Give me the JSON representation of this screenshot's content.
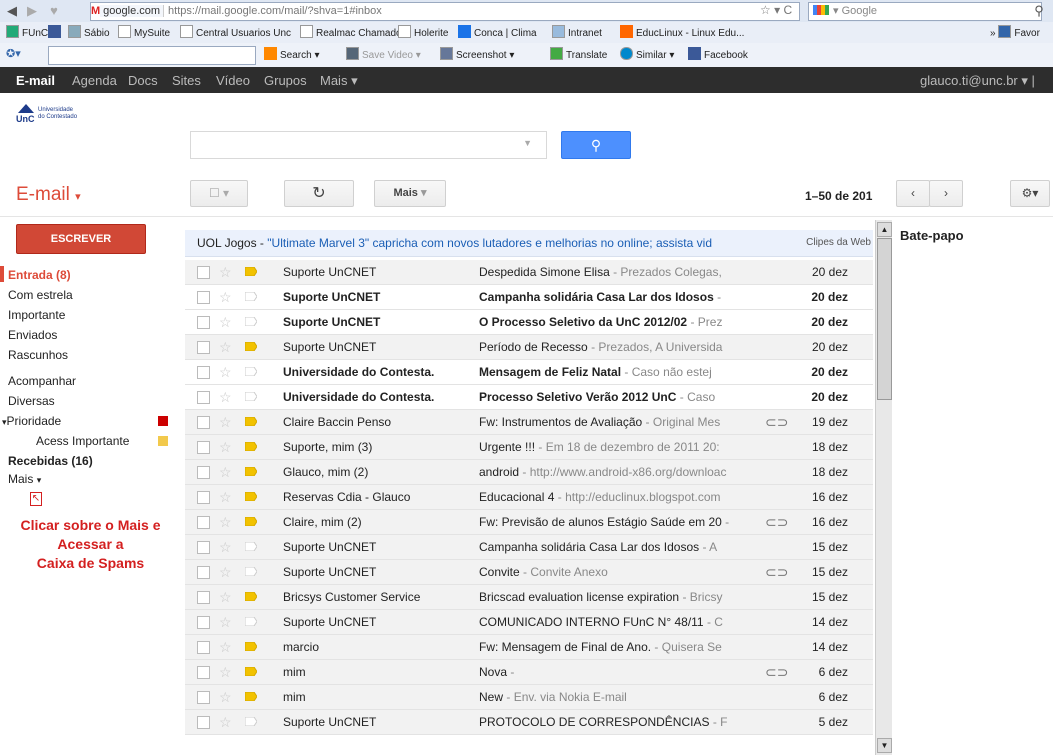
{
  "browser": {
    "domain": "google.com",
    "url": "https://mail.google.com/mail/?shva=1#inbox",
    "search_engine": "Google",
    "bookmarks": [
      "FUnC",
      "Sábio",
      "MySuite",
      "Central Usuarios Unc",
      "Realmac Chamados",
      "Holerite",
      "Conca | Clima",
      "Intranet",
      "EducLinux - Linux Edu...",
      "Favor"
    ],
    "toolbar": [
      "Search",
      "Save Video",
      "Screenshot",
      "Translate",
      "Similar",
      "Facebook"
    ]
  },
  "gbar": {
    "items": [
      "E-mail",
      "Agenda",
      "Docs",
      "Sites",
      "Vídeo",
      "Grupos",
      "Mais"
    ],
    "account": "glauco.ti@unc.br"
  },
  "logo": {
    "line1": "Universidade",
    "line2": "do Contestado",
    "mark": "UnC"
  },
  "header": {
    "mail_label": "E-mail",
    "more_button": "Mais",
    "pager": "1–50 de 201"
  },
  "sidebar": {
    "compose": "ESCREVER",
    "items": [
      {
        "label": "Entrada (8)"
      },
      {
        "label": "Com estrela"
      },
      {
        "label": "Importante"
      },
      {
        "label": "Enviados"
      },
      {
        "label": "Rascunhos"
      },
      {
        "label": "Acompanhar"
      },
      {
        "label": "Diversas"
      },
      {
        "label": "Prioridade"
      },
      {
        "label": "Acess Importante"
      },
      {
        "label": "Recebidas (16)"
      },
      {
        "label": "Mais"
      }
    ],
    "annotation": [
      "Clicar sobre o Mais e",
      "Acessar a",
      "Caixa de Spams"
    ]
  },
  "promo": {
    "source": "UOL Jogos",
    "text": "\"Ultimate Marvel 3\" capricha com novos lutadores e melhorias no online; assista vid",
    "clips": "Clipes da Web"
  },
  "emails": [
    {
      "sender": "Suporte UnCNET",
      "subject": "Despedida Simone Elisa",
      "snippet": "Prezados Colegas,",
      "date": "20 dez",
      "unread": false,
      "important": true,
      "attach": false
    },
    {
      "sender": "Suporte UnCNET",
      "subject": "Campanha solidária Casa Lar dos Idosos",
      "snippet": "",
      "date": "20 dez",
      "unread": true,
      "important": false,
      "attach": false
    },
    {
      "sender": "Suporte UnCNET",
      "subject": "O Processo Seletivo da UnC 2012/02",
      "snippet": "Prez",
      "date": "20 dez",
      "unread": true,
      "important": false,
      "attach": false
    },
    {
      "sender": "Suporte UnCNET",
      "subject": "Período de Recesso",
      "snippet": "Prezados, A Universida",
      "date": "20 dez",
      "unread": false,
      "important": true,
      "attach": false
    },
    {
      "sender": "Universidade do Contesta.",
      "subject": "Mensagem de Feliz Natal",
      "snippet": "Caso não estej",
      "date": "20 dez",
      "unread": true,
      "important": false,
      "attach": false
    },
    {
      "sender": "Universidade do Contesta.",
      "subject": "Processo Seletivo Verão 2012 UnC",
      "snippet": "Caso",
      "date": "20 dez",
      "unread": true,
      "important": false,
      "attach": false
    },
    {
      "sender": "Claire Baccin Penso",
      "subject": "Fw: Instrumentos de Avaliação",
      "snippet": "Original Mes",
      "date": "19 dez",
      "unread": false,
      "important": true,
      "attach": true
    },
    {
      "sender": "Suporte, mim (3)",
      "subject": "Urgente !!!",
      "snippet": "Em 18 de dezembro de 2011 20:",
      "date": "18 dez",
      "unread": false,
      "important": true,
      "attach": false
    },
    {
      "sender": "Glauco, mim (2)",
      "subject": "android",
      "snippet": "http://www.android-x86.org/downloac",
      "date": "18 dez",
      "unread": false,
      "important": true,
      "attach": false
    },
    {
      "sender": "Reservas Cdia - Glauco",
      "subject": "Educacional 4",
      "snippet": "http://educlinux.blogspot.com",
      "date": "16 dez",
      "unread": false,
      "important": true,
      "attach": false
    },
    {
      "sender": "Claire, mim (2)",
      "subject": "Fw: Previsão de alunos Estágio Saúde em 20",
      "snippet": "",
      "date": "16 dez",
      "unread": false,
      "important": true,
      "attach": true
    },
    {
      "sender": "Suporte UnCNET",
      "subject": "Campanha solidária Casa Lar dos Idosos",
      "snippet": "A",
      "date": "15 dez",
      "unread": false,
      "important": false,
      "attach": false
    },
    {
      "sender": "Suporte UnCNET",
      "subject": "Convite",
      "snippet": "Convite Anexo",
      "date": "15 dez",
      "unread": false,
      "important": false,
      "attach": true
    },
    {
      "sender": "Bricsys Customer Service",
      "subject": "Bricscad evaluation license expiration",
      "snippet": "Bricsy",
      "date": "15 dez",
      "unread": false,
      "important": true,
      "attach": false
    },
    {
      "sender": "Suporte UnCNET",
      "subject": "COMUNICADO INTERNO FUnC N° 48/11",
      "snippet": "C",
      "date": "14 dez",
      "unread": false,
      "important": false,
      "attach": false
    },
    {
      "sender": "marcio",
      "subject": "Fw: Mensagem de Final de Ano.",
      "snippet": "Quisera Se",
      "date": "14 dez",
      "unread": false,
      "important": true,
      "attach": false
    },
    {
      "sender": "mim",
      "subject": "Nova",
      "snippet": "",
      "date": "6 dez",
      "unread": false,
      "important": true,
      "attach": true
    },
    {
      "sender": "mim",
      "subject": "New",
      "snippet": "Env. via Nokia E-mail",
      "date": "6 dez",
      "unread": false,
      "important": true,
      "attach": false
    },
    {
      "sender": "Suporte UnCNET",
      "subject": "PROTOCOLO DE CORRESPONDÊNCIAS",
      "snippet": "F",
      "date": "5 dez",
      "unread": false,
      "important": false,
      "attach": false
    }
  ],
  "chat": {
    "title": "Bate-papo"
  },
  "colors": {
    "accent": "#dd4b39",
    "compose": "#d14836",
    "important": "#f2c200",
    "blue": "#4d90fe",
    "prioridade": "#cc0000",
    "acess": "#f2c94c"
  }
}
